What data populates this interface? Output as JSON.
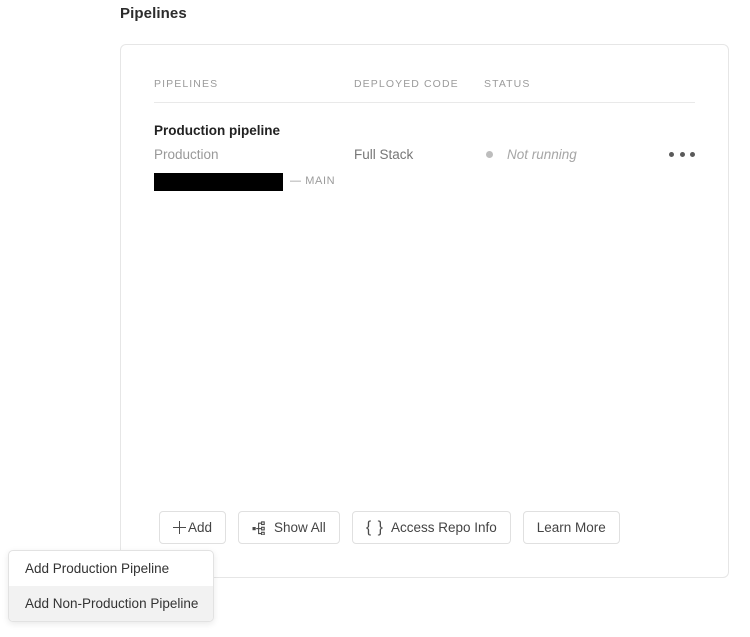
{
  "page": {
    "title": "Pipelines"
  },
  "table": {
    "columns": {
      "pipelines": "PIPELINES",
      "deployed_code": "DEPLOYED CODE",
      "status": "STATUS"
    },
    "rows": [
      {
        "name": "Production pipeline",
        "environment": "Production",
        "repository_redacted": "",
        "branch": "— MAIN",
        "deployed_code": "Full Stack",
        "status": "Not running",
        "status_dot_color": "#bdbdbd",
        "menu_icon": "ellipsis-icon"
      }
    ]
  },
  "actions": {
    "add": {
      "label": "Add",
      "icon": "plus-icon"
    },
    "show_all": {
      "label": "Show All",
      "icon": "hierarchy-icon"
    },
    "access_repo_info": {
      "label": "Access Repo Info",
      "icon": "curly-braces-icon"
    },
    "learn_more": {
      "label": "Learn More"
    }
  },
  "add_menu": {
    "items": [
      {
        "label": "Add Production Pipeline",
        "highlighted": false
      },
      {
        "label": "Add Non-Production Pipeline",
        "highlighted": true
      }
    ]
  },
  "colors": {
    "card_border": "#e6e6e6",
    "muted_text": "#9b9b9b",
    "status_text": "#a6a6a6",
    "redaction": "#000000",
    "menu_highlight": "#f2f2f2"
  }
}
